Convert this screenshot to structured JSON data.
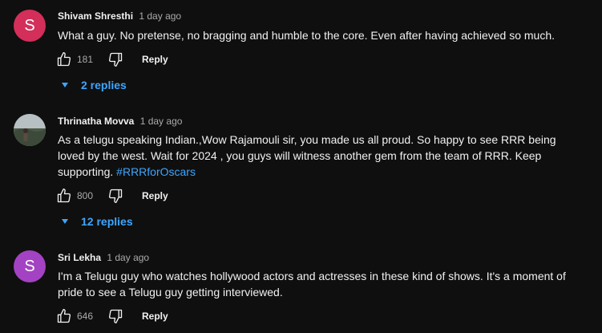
{
  "comments": [
    {
      "author": "Shivam Shresthi",
      "time": "1 day ago",
      "avatar_letter": "S",
      "avatar_color": "#d32f5a",
      "text_lines": [
        "What a guy. No pretense, no bragging and humble to the core. Even after having achieved so much."
      ],
      "likes": "181",
      "reply_label": "Reply",
      "replies_label": "2 replies"
    },
    {
      "author": "Thrinatha Movva",
      "time": "1 day ago",
      "avatar_letter": "",
      "avatar_color": "#6f7a73",
      "text_lines": [
        "As a telugu speaking Indian.,Wow Rajamouli sir, you made us all proud. So happy to see RRR being",
        "loved by the west. Wait for 2024 , you guys will witness another gem from the team of RRR. Keep",
        "supporting. "
      ],
      "hashtag": "#RRRforOscars",
      "likes": "800",
      "reply_label": "Reply",
      "replies_label": "12 replies"
    },
    {
      "author": "Sri Lekha",
      "time": "1 day ago",
      "avatar_letter": "S",
      "avatar_color": "#a342c2",
      "text_lines": [
        "I'm a Telugu guy who watches hollywood actors and actresses in these kind of shows. It's a moment of",
        "pride to see a Telugu guy getting interviewed."
      ],
      "likes": "646",
      "reply_label": "Reply"
    }
  ]
}
